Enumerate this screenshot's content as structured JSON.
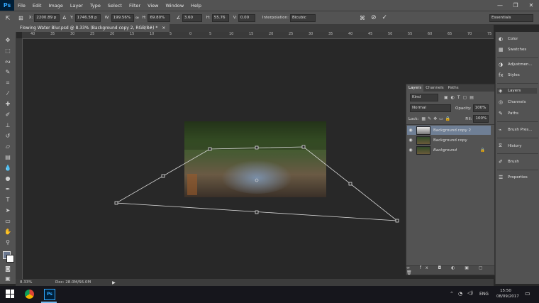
{
  "menubar": {
    "logo": "Ps",
    "items": [
      "File",
      "Edit",
      "Image",
      "Layer",
      "Type",
      "Select",
      "Filter",
      "View",
      "Window",
      "Help"
    ],
    "controls": [
      "—",
      "❐",
      "✕"
    ]
  },
  "options": {
    "x_label": "X:",
    "x_value": "2200.89 p",
    "y_label": "Y:",
    "y_value": "1746.58 p",
    "w_label": "W:",
    "w_value": "199.56%",
    "h_label": "H:",
    "h_value": "69.80%",
    "angle_value": "3.60",
    "h2_label": "H:",
    "h2_value": "55.76",
    "v_label": "V:",
    "v_value": "0.00",
    "interp_label": "Interpolation:",
    "interp_value": "Bicubic",
    "workspace": "Essentials"
  },
  "document": {
    "tab_title": "Flowing Water Blur.psd @ 8.33% (Background copy 2, RGB/8#) *",
    "close": "×"
  },
  "ruler": {
    "ticks": [
      "40",
      "35",
      "30",
      "25",
      "20",
      "15",
      "10",
      "5",
      "0",
      "5",
      "10",
      "15",
      "20",
      "25",
      "30",
      "35",
      "40",
      "45",
      "50",
      "55",
      "60",
      "65",
      "70",
      "75"
    ]
  },
  "status": {
    "zoom": "8.33%",
    "doc": "Doc: 28.0M/56.0M"
  },
  "layers_panel": {
    "tabs": [
      "Layers",
      "Channels",
      "Paths"
    ],
    "kind": "Kind",
    "blend_mode": "Normal",
    "opacity_label": "Opacity:",
    "opacity_value": "100%",
    "lock_label": "Lock:",
    "fill_label": "Fill:",
    "fill_value": "100%",
    "layers": [
      {
        "name": "Background copy 2",
        "selected": true
      },
      {
        "name": "Background copy",
        "selected": false
      },
      {
        "name": "Background",
        "selected": false
      }
    ]
  },
  "dock": {
    "groups": [
      [
        "Color",
        "Swatches"
      ],
      [
        "Adjustmen...",
        "Styles"
      ],
      [
        "Layers",
        "Channels",
        "Paths"
      ],
      [
        "Brush Pres..."
      ],
      [
        "History"
      ],
      [
        "Brush"
      ],
      [
        "Properties"
      ]
    ]
  },
  "taskbar": {
    "lang": "ENG",
    "time": "15:50",
    "date": "08/09/2017"
  },
  "colors": {
    "accent": "#31a8ff",
    "selected_layer": "#6f7f95"
  }
}
